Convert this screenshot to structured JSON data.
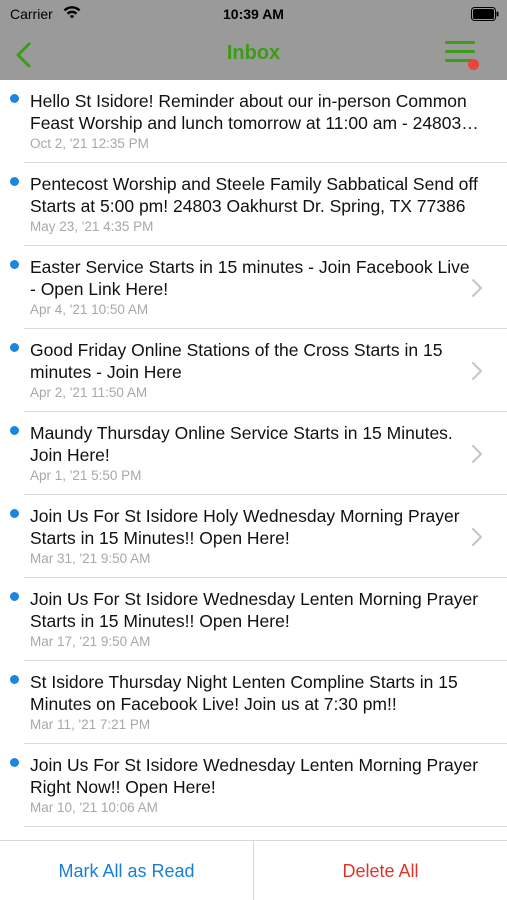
{
  "status_bar": {
    "carrier": "Carrier",
    "time": "10:39 AM"
  },
  "nav": {
    "title": "Inbox",
    "back_icon": "chevron-left-icon",
    "menu_icon": "hamburger-menu-icon",
    "menu_has_badge": true,
    "accent_color": "#3c9c14",
    "badge_color": "#e8453c"
  },
  "messages": [
    {
      "text": "Hello St Isidore!  Reminder about our in-person Common Feast Worship and lunch tomorrow at 11:00 am - 24803…",
      "date": "Oct 2, '21 12:35 PM",
      "unread": true,
      "has_chevron": false
    },
    {
      "text": "Pentecost Worship and Steele Family Sabbatical Send off Starts at 5:00 pm!  24803 Oakhurst Dr. Spring, TX 77386",
      "date": "May 23, '21 4:35 PM",
      "unread": true,
      "has_chevron": false
    },
    {
      "text": "Easter Service Starts in 15 minutes - Join Facebook Live - Open Link Here!",
      "date": "Apr 4, '21 10:50 AM",
      "unread": true,
      "has_chevron": true
    },
    {
      "text": "Good Friday Online Stations of the Cross Starts in 15 minutes - Join Here",
      "date": "Apr 2, '21 11:50 AM",
      "unread": true,
      "has_chevron": true
    },
    {
      "text": "Maundy Thursday Online Service Starts in 15 Minutes. Join Here!",
      "date": "Apr 1, '21 5:50 PM",
      "unread": true,
      "has_chevron": true
    },
    {
      "text": "Join Us For St Isidore Holy Wednesday Morning Prayer Starts in 15 Minutes!! Open Here!",
      "date": "Mar 31, '21 9:50 AM",
      "unread": true,
      "has_chevron": true
    },
    {
      "text": "Join Us For St Isidore Wednesday Lenten Morning Prayer Starts in 15 Minutes!! Open Here!",
      "date": "Mar 17, '21 9:50 AM",
      "unread": true,
      "has_chevron": false
    },
    {
      "text": "St Isidore Thursday Night Lenten Compline Starts in 15 Minutes on Facebook Live! Join us at 7:30 pm!!",
      "date": "Mar 11, '21 7:21 PM",
      "unread": true,
      "has_chevron": false
    },
    {
      "text": "Join Us For St Isidore Wednesday Lenten Morning Prayer Right Now!! Open Here!",
      "date": "Mar 10, '21 10:06 AM",
      "unread": true,
      "has_chevron": false
    }
  ],
  "toolbar": {
    "mark_all_read_label": "Mark All as Read",
    "delete_all_label": "Delete All",
    "mark_color": "#1a7fd4",
    "delete_color": "#e0352b"
  }
}
